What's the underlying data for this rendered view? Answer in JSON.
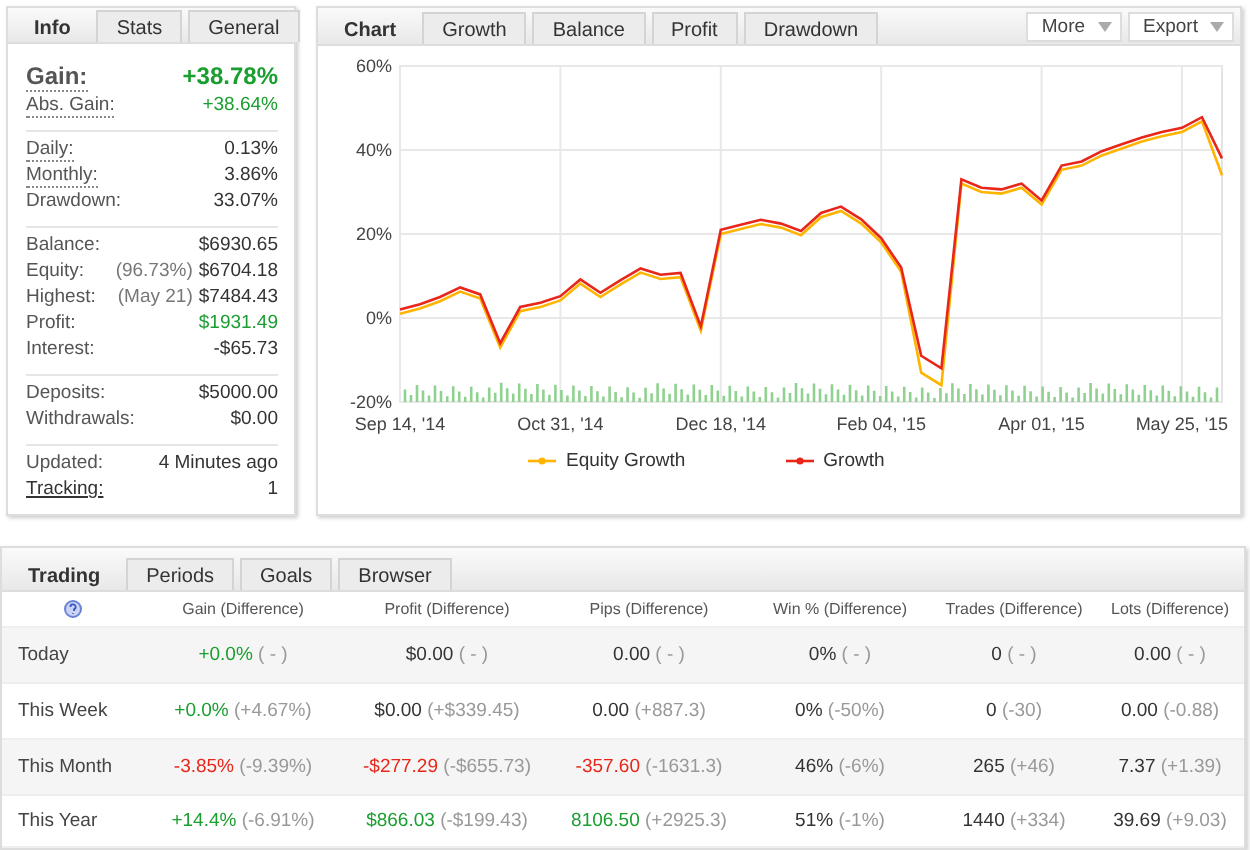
{
  "info": {
    "tabs": [
      {
        "label": "Info",
        "selected": true
      },
      {
        "label": "Stats",
        "selected": false
      },
      {
        "label": "General",
        "selected": false
      }
    ],
    "sections": [
      {
        "rows": [
          {
            "label": "Gain:",
            "value": "+38.78%",
            "kind": "headline",
            "color": "#1a9e2f",
            "dotted_underline": true,
            "link": false
          },
          {
            "label": "Abs. Gain:",
            "value": "+38.64%",
            "color": "#1a9e2f",
            "dotted_underline": true,
            "link": false
          }
        ]
      },
      {
        "rows": [
          {
            "label": "Daily:",
            "value": "0.13%",
            "color": "#333333",
            "dotted_underline": true,
            "link": false
          },
          {
            "label": "Monthly:",
            "value": "3.86%",
            "color": "#333333",
            "dotted_underline": true,
            "link": false
          },
          {
            "label": "Drawdown:",
            "value": "33.07%",
            "color": "#333333",
            "dotted_underline": false,
            "link": false
          }
        ]
      },
      {
        "rows": [
          {
            "label": "Balance:",
            "value": "$6930.65",
            "color": "#333333",
            "dotted_underline": false,
            "link": false
          },
          {
            "label": "Equity:",
            "note": "(96.73%)",
            "value": "$6704.18",
            "color": "#333333",
            "dotted_underline": false,
            "link": false
          },
          {
            "label": "Highest:",
            "note": "(May 21)",
            "value": "$7484.43",
            "color": "#333333",
            "dotted_underline": false,
            "link": false
          },
          {
            "label": "Profit:",
            "value": "$1931.49",
            "color": "#1a9e2f",
            "dotted_underline": false,
            "link": false
          },
          {
            "label": "Interest:",
            "value": "-$65.73",
            "color": "#333333",
            "dotted_underline": false,
            "link": false
          }
        ]
      },
      {
        "rows": [
          {
            "label": "Deposits:",
            "value": "$5000.00",
            "color": "#333333",
            "dotted_underline": false,
            "link": false
          },
          {
            "label": "Withdrawals:",
            "value": "$0.00",
            "color": "#333333",
            "dotted_underline": false,
            "link": false
          }
        ]
      },
      {
        "rows": [
          {
            "label": "Updated:",
            "value": "4 Minutes ago",
            "color": "#333333",
            "dotted_underline": false,
            "link": false
          },
          {
            "label": "Tracking:",
            "value": "1",
            "color": "#333333",
            "dotted_underline": false,
            "link": true
          }
        ]
      }
    ]
  },
  "chart_panel": {
    "tabs": [
      {
        "label": "Chart",
        "selected": true
      },
      {
        "label": "Growth",
        "selected": false
      },
      {
        "label": "Balance",
        "selected": false
      },
      {
        "label": "Profit",
        "selected": false
      },
      {
        "label": "Drawdown",
        "selected": false
      }
    ],
    "buttons": [
      "More",
      "Export"
    ],
    "chart_data": {
      "type": "line",
      "categories": [
        "Sep 14, '14",
        null,
        null,
        null,
        null,
        null,
        null,
        null,
        "Oct 31, '14",
        null,
        null,
        null,
        null,
        null,
        null,
        null,
        "Dec 18, '14",
        null,
        null,
        null,
        null,
        null,
        null,
        null,
        "Feb 04, '15",
        null,
        null,
        null,
        null,
        null,
        null,
        null,
        "Apr 01, '15",
        null,
        null,
        null,
        null,
        null,
        null,
        "May 25, '15",
        null,
        null
      ],
      "series": [
        {
          "name": "Equity Growth",
          "color": "#ffb400",
          "values": [
            1,
            2.3,
            4,
            6.3,
            4.6,
            -7,
            1.6,
            2.6,
            4.2,
            8.2,
            5,
            8,
            10.8,
            9.3,
            9.7,
            -3,
            20,
            21.2,
            22.4,
            21.5,
            19.7,
            24,
            25.5,
            22.5,
            18,
            11,
            -13,
            -16,
            32,
            30,
            29.6,
            31,
            27,
            35.3,
            36.3,
            38.7,
            40.4,
            42,
            43.3,
            44.3,
            46.8,
            34
          ]
        },
        {
          "name": "Growth",
          "color": "#e8261a",
          "values": [
            2,
            3.3,
            5,
            7.3,
            5.6,
            -6,
            2.6,
            3.6,
            5.2,
            9.2,
            6,
            9,
            11.8,
            10.3,
            10.7,
            -2,
            21,
            22.2,
            23.4,
            22.5,
            20.7,
            25,
            26.5,
            23.5,
            19,
            12,
            -9,
            -12,
            33,
            31,
            30.6,
            32,
            28,
            36.3,
            37.3,
            39.7,
            41.4,
            43,
            44.3,
            45.3,
            47.8,
            38
          ]
        }
      ],
      "grid": true,
      "ylim": [
        -20,
        60
      ],
      "yticks": [
        {
          "value": -20,
          "label": "-20%"
        },
        {
          "value": 0,
          "label": "0%"
        },
        {
          "value": 20,
          "label": "20%"
        },
        {
          "value": 40,
          "label": "40%"
        },
        {
          "value": 60,
          "label": "60%"
        }
      ]
    }
  },
  "trading": {
    "tabs": [
      {
        "label": "Trading",
        "selected": true
      },
      {
        "label": "Periods",
        "selected": false
      },
      {
        "label": "Goals",
        "selected": false
      },
      {
        "label": "Browser",
        "selected": false
      }
    ],
    "columns": [
      "Gain (Difference)",
      "Profit (Difference)",
      "Pips (Difference)",
      "Win % (Difference)",
      "Trades (Difference)",
      "Lots (Difference)"
    ],
    "rows": [
      {
        "period": "Today",
        "cells": [
          {
            "value": "+0.0%",
            "diff": "( - )",
            "color": "#1a9e2f"
          },
          {
            "value": "$0.00",
            "diff": "( - )",
            "color": "#333333"
          },
          {
            "value": "0.00",
            "diff": "( - )",
            "color": "#333333"
          },
          {
            "value": "0%",
            "diff": "( - )",
            "color": "#333333"
          },
          {
            "value": "0",
            "diff": "( - )",
            "color": "#333333"
          },
          {
            "value": "0.00",
            "diff": "( - )",
            "color": "#333333"
          }
        ]
      },
      {
        "period": "This Week",
        "cells": [
          {
            "value": "+0.0%",
            "diff": "(+4.67%)",
            "color": "#1a9e2f"
          },
          {
            "value": "$0.00",
            "diff": "(+$339.45)",
            "color": "#333333"
          },
          {
            "value": "0.00",
            "diff": "(+887.3)",
            "color": "#333333"
          },
          {
            "value": "0%",
            "diff": "(-50%)",
            "color": "#333333"
          },
          {
            "value": "0",
            "diff": "(-30)",
            "color": "#333333"
          },
          {
            "value": "0.00",
            "diff": "(-0.88)",
            "color": "#333333"
          }
        ]
      },
      {
        "period": "This Month",
        "cells": [
          {
            "value": "-3.85%",
            "diff": "(-9.39%)",
            "color": "#e8261a"
          },
          {
            "value": "-$277.29",
            "diff": "(-$655.73)",
            "color": "#e8261a"
          },
          {
            "value": "-357.60",
            "diff": "(-1631.3)",
            "color": "#e8261a"
          },
          {
            "value": "46%",
            "diff": "(-6%)",
            "color": "#333333"
          },
          {
            "value": "265",
            "diff": "(+46)",
            "color": "#333333"
          },
          {
            "value": "7.37",
            "diff": "(+1.39)",
            "color": "#333333"
          }
        ]
      },
      {
        "period": "This Year",
        "cells": [
          {
            "value": "+14.4%",
            "diff": "(-6.91%)",
            "color": "#1a9e2f"
          },
          {
            "value": "$866.03",
            "diff": "(-$199.43)",
            "color": "#1a9e2f"
          },
          {
            "value": "8106.50",
            "diff": "(+2925.3)",
            "color": "#1a9e2f"
          },
          {
            "value": "51%",
            "diff": "(-1%)",
            "color": "#333333"
          },
          {
            "value": "1440",
            "diff": "(+334)",
            "color": "#333333"
          },
          {
            "value": "39.69",
            "diff": "(+9.03)",
            "color": "#333333"
          }
        ]
      }
    ]
  }
}
